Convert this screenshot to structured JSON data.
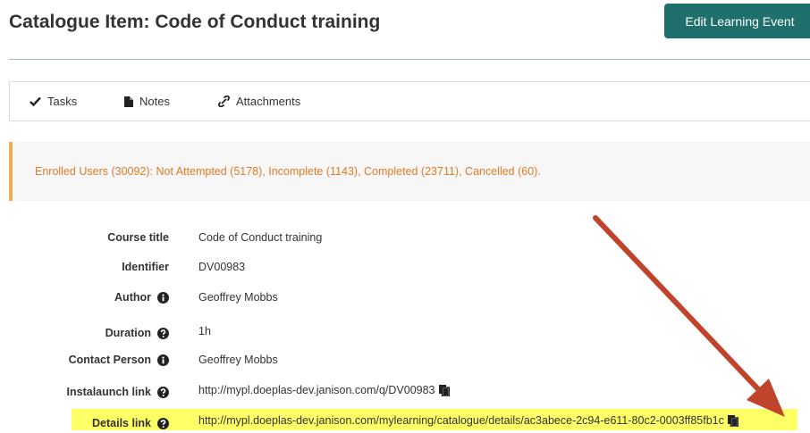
{
  "header": {
    "title": "Catalogue Item: Code of Conduct training",
    "edit_button": "Edit Learning Event"
  },
  "tabs": [
    {
      "label": "Tasks",
      "icon": "check-icon"
    },
    {
      "label": "Notes",
      "icon": "file-icon"
    },
    {
      "label": "Attachments",
      "icon": "link-icon"
    }
  ],
  "alert": {
    "text": "Enrolled Users (30092): Not Attempted (5178), Incomplete (1143), Completed (23711), Cancelled (60).",
    "color": "#e07b25"
  },
  "details": [
    {
      "label": "Course title",
      "value": "Code of Conduct training"
    },
    {
      "label": "Identifier",
      "value": "DV00983"
    },
    {
      "label": "Author",
      "value": "Geoffrey Mobbs",
      "icon": "info-circle-icon"
    },
    {
      "label": "Duration",
      "value": "1h",
      "icon": "question-circle-icon"
    },
    {
      "label": "Contact Person",
      "value": "Geoffrey Mobbs",
      "icon": "info-circle-icon"
    },
    {
      "label": "Instalaunch link",
      "value": "http://mypl.doeplas-dev.janison.com/q/DV00983",
      "icon": "question-circle-icon"
    },
    {
      "label": "Details link",
      "value": "http://mypl.doeplas-dev.janison.com/mylearning/catalogue/details/ac3abece-2c94-e611-80c2-0003ff85fb1c",
      "icon": "question-circle-icon"
    }
  ],
  "colors": {
    "accent": "#1f6f6c",
    "warning_border": "#f0ad4e",
    "highlight": "#ffff66",
    "arrow": "#c0432c"
  }
}
